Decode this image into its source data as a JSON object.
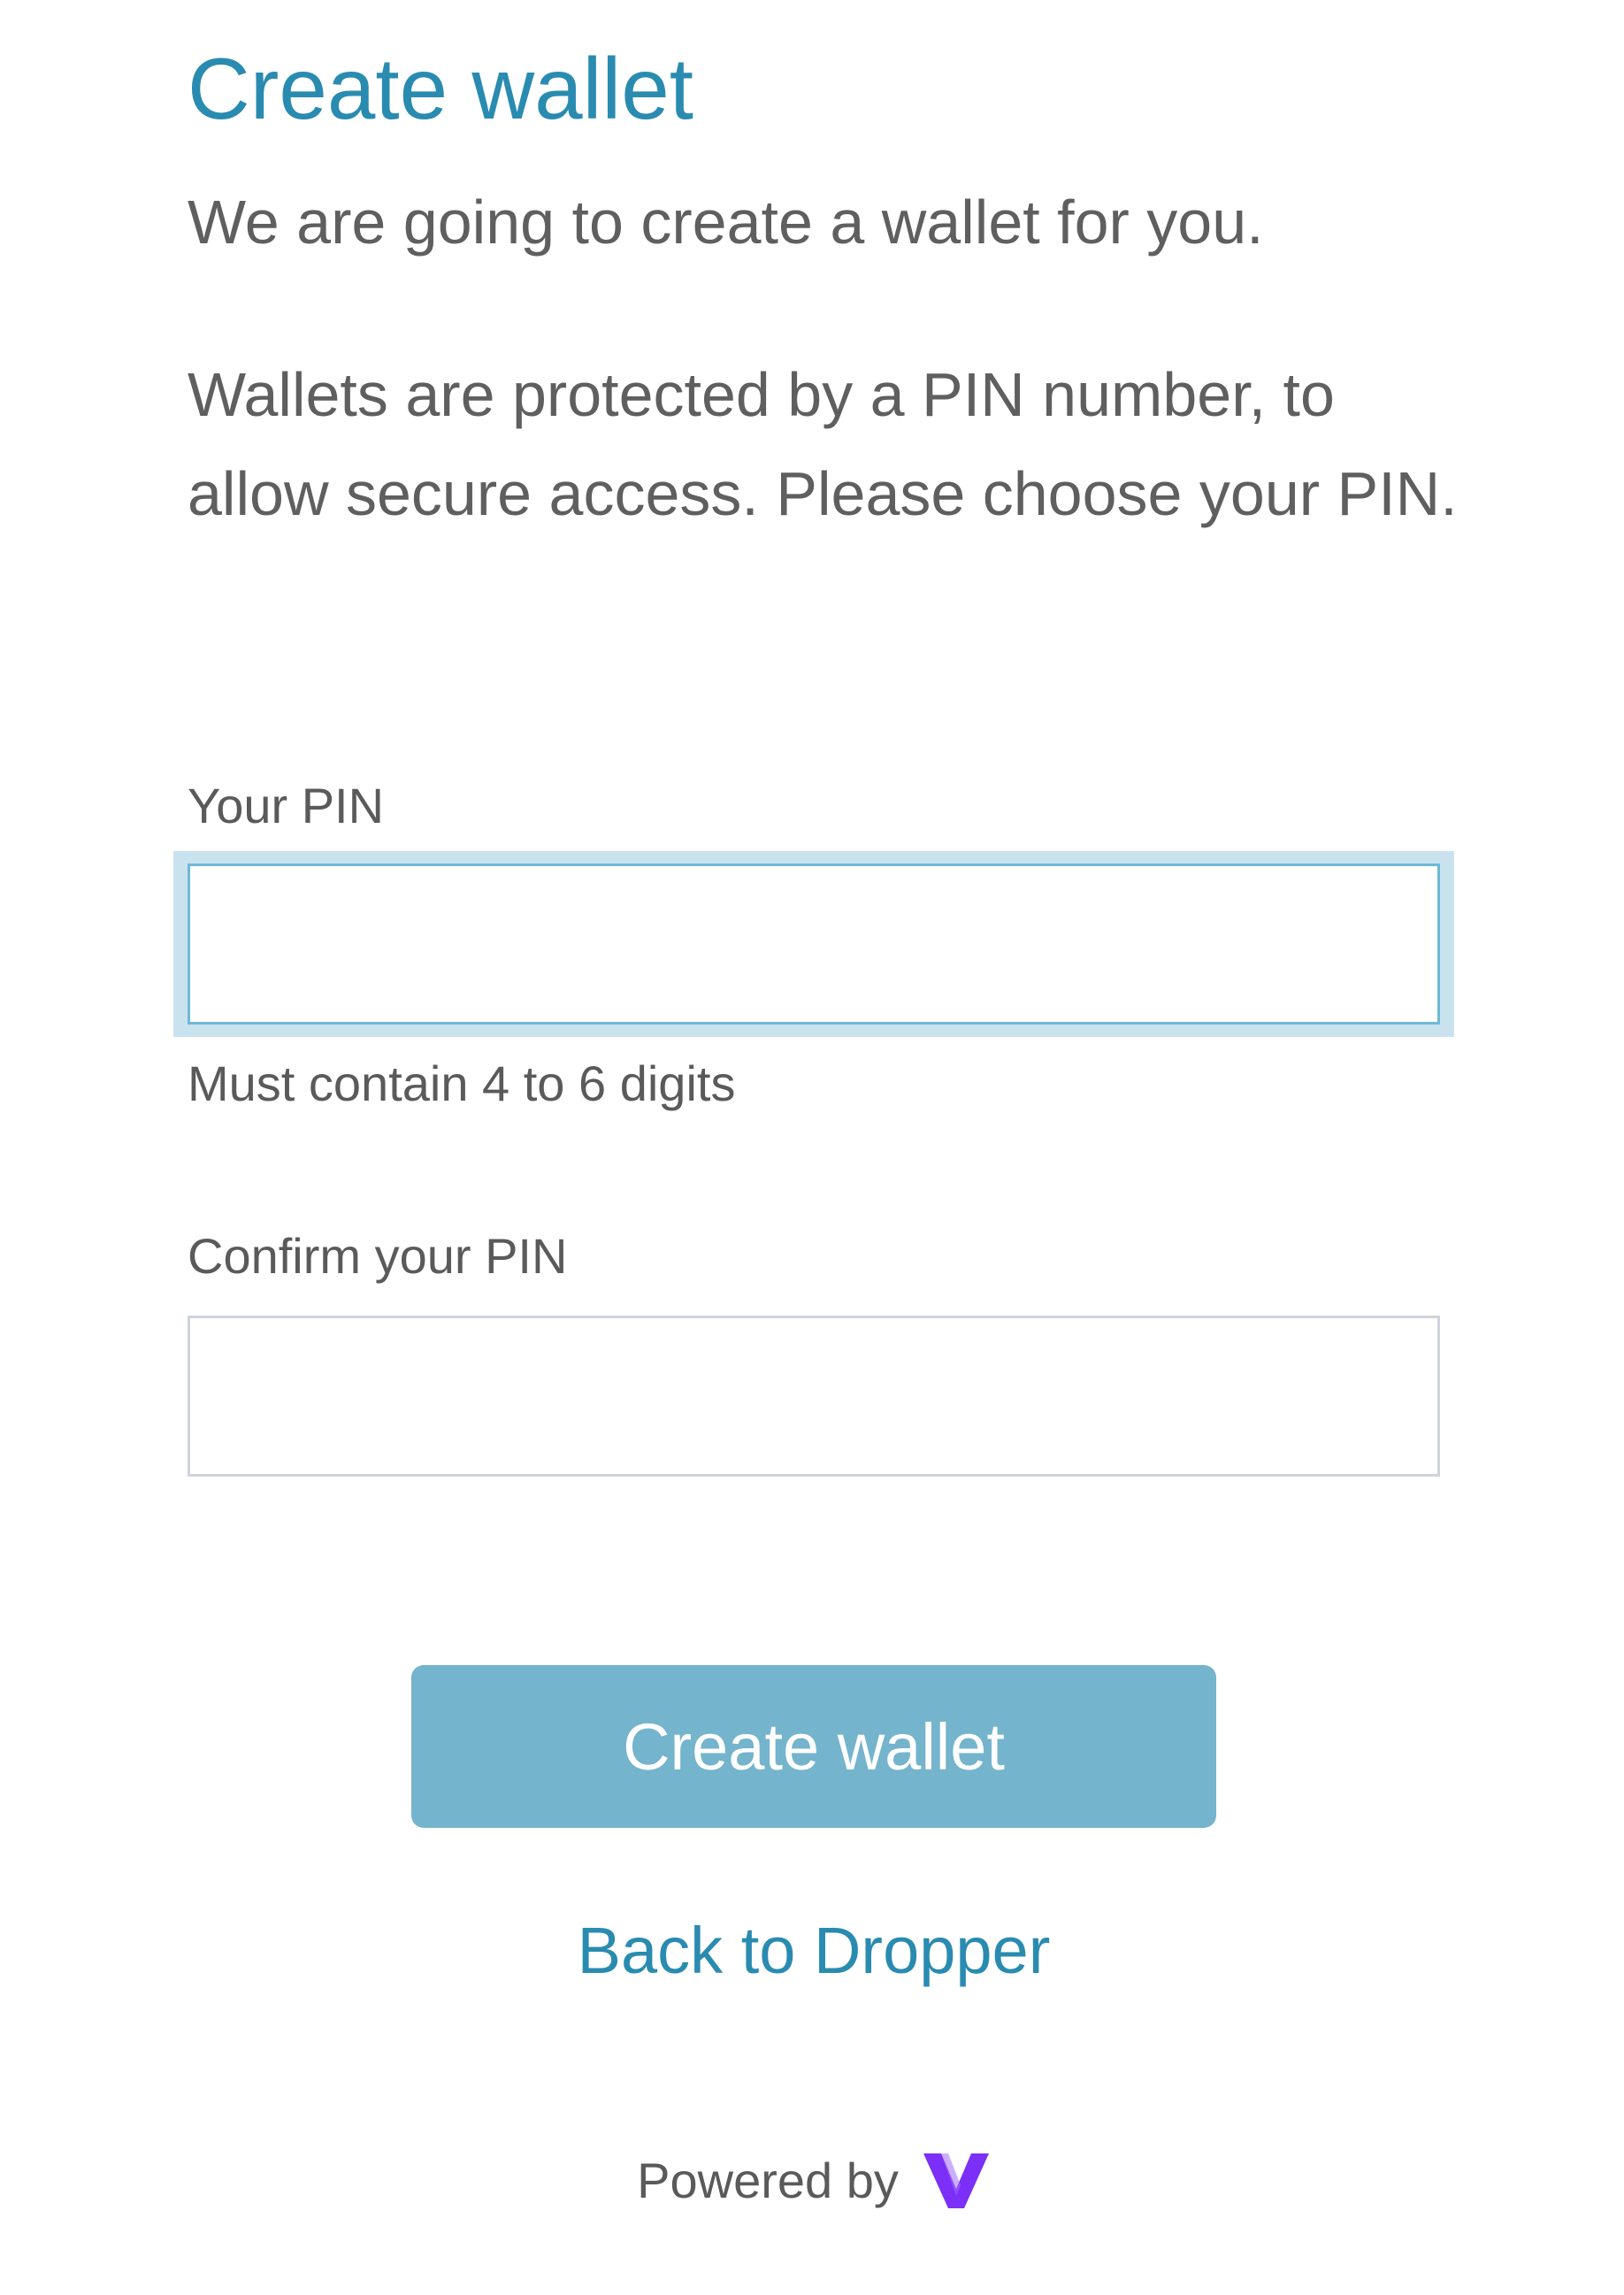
{
  "page": {
    "title": "Create wallet",
    "intro": "We are going to create a wallet for you.",
    "info": "Wallets are protected by a PIN number, to allow secure access. Please choose your PIN."
  },
  "form": {
    "pin_label": "Your PIN",
    "pin_value": "",
    "pin_hint": "Must contain 4 to 6 digits",
    "confirm_label": "Confirm your PIN",
    "confirm_value": ""
  },
  "actions": {
    "create_label": "Create wallet",
    "back_label": "Back to Dropper"
  },
  "footer": {
    "powered_by": "Powered by",
    "logo_icon": "v-logo-icon",
    "logo_color": "#7b2ff7"
  },
  "colors": {
    "accent": "#2a8bb0",
    "button": "#74b4cc",
    "focus_ring": "#c9e3ee"
  }
}
